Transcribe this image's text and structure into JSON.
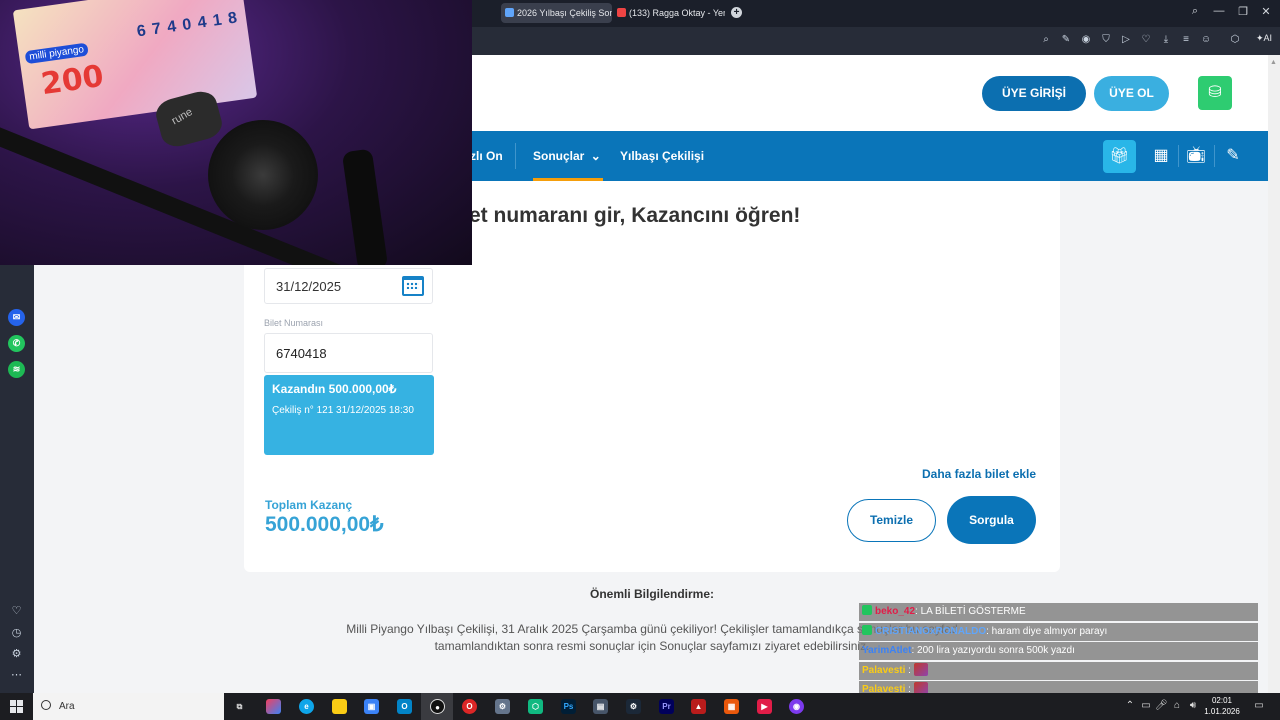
{
  "browser": {
    "tabs": [
      {
        "title": "2026 Yılbaşı Çekiliş Sonuç",
        "active": true,
        "icon": "globe-icon"
      },
      {
        "title": "(133) Ragga Oktay - Yenic",
        "active": false,
        "icon": "youtube-icon"
      }
    ],
    "new_tab_symbol": "+",
    "ai_label": "AI"
  },
  "site": {
    "login_label": "ÜYE GİRİŞİ",
    "register_label": "ÜYE OL",
    "nav": {
      "partial_item": "zlı On",
      "results_label": "Sonuçlar",
      "new_year_label": "Yılbaşı Çekilişi"
    },
    "accent_color": "#0a75b9"
  },
  "form": {
    "title": "et numaranı gir, Kazancını öğren!",
    "date_value": "31/12/2025",
    "ticket_label": "Bilet Numarası",
    "ticket_value": "6740418",
    "win_title": "Kazandın 500.000,00₺",
    "win_sub": "Çekiliş n° 121 31/12/2025 18:30",
    "add_more_label": "Daha fazla bilet ekle",
    "total_label": "Toplam Kazanç",
    "total_value": "500.000,00₺",
    "clear_label": "Temizle",
    "query_label": "Sorgula"
  },
  "info": {
    "title": "Önemli Bilgilendirme:",
    "line1": "Milli Piyango Yılbaşı Çekilişi, 31 Aralık 2025 Çarşamba günü çekiliyor! Çekilişler tamamlandıkça sonuçlar bu sayfad",
    "line2": "tamamlandıktan sonra resmi sonuçlar için Sonuçlar sayfamızı ziyaret edebilirsiniz."
  },
  "webcam": {
    "ticket_brand": "milli piyango",
    "ticket_big_number": "200",
    "ticket_digits": "6 7 4 0 4 1 8",
    "ring_text": "rune"
  },
  "chat": [
    {
      "user": "beko_42",
      "message": ": LA BİLETİ GÖSTERME",
      "user_color": "#e11d48",
      "badge_color": "#22c55e"
    },
    {
      "user": "CRISTIANOxRONALDO",
      "message": ": haram diye almıyor parayı",
      "user_color": "#60a5fa",
      "badge_color": "#22c55e"
    },
    {
      "user": "YarimAtlet",
      "message": ": 200 lira yazıyordu sonra 500k yazdı",
      "user_color": "#3b82f6",
      "badge_color": ""
    },
    {
      "user": "Palavesti",
      "message": " :",
      "user_color": "#facc15",
      "badge_color": ""
    },
    {
      "user": "Palavesti",
      "message": " :",
      "user_color": "#facc15",
      "badge_color": ""
    },
    {
      "user": "Palavesti",
      "message": " :",
      "user_color": "#facc15",
      "badge_color": ""
    }
  ],
  "taskbar": {
    "search_placeholder": "Ara",
    "time": "02:01",
    "date": "1.01.2026"
  }
}
